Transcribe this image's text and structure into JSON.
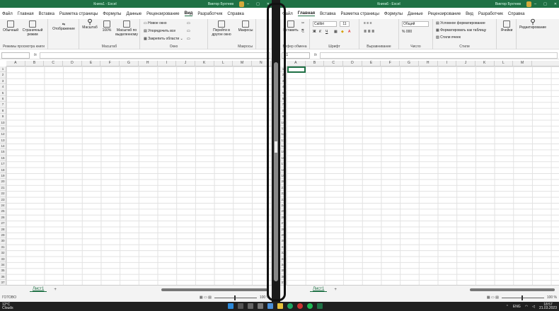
{
  "left_window": {
    "title": "Книга1 - Excel",
    "user": "Виктор Бухтеев",
    "menu": [
      "Файл",
      "Главная",
      "Вставка",
      "Разметка страницы",
      "Формулы",
      "Данные",
      "Рецензирование",
      "Вид",
      "Разработчик",
      "Справка"
    ],
    "active_menu": "Вид",
    "ribbon": {
      "normal": "Обычный",
      "page_mode": "Страничный режим",
      "views_group": "Режимы просмотра книги",
      "display": "Отображение",
      "zoom": "Масштаб",
      "zoom_100": "100%",
      "zoom_selection": "Масштаб по выделенному",
      "zoom_group": "Масштаб",
      "new_window": "Новое окно",
      "arrange_all": "Упорядочить все",
      "freeze_panes": "Закрепить области",
      "window_group": "Окно",
      "switch_windows": "Перейти в другое окно",
      "macros": "Макросы",
      "macros_group": "Макросы"
    },
    "columns": [
      "A",
      "B",
      "C",
      "D",
      "E",
      "F",
      "G",
      "H",
      "I",
      "J",
      "K",
      "L",
      "M",
      "N"
    ],
    "sheet_tab": "Лист1",
    "status_left": "ГОТОВО",
    "zoom_pct": "100 %"
  },
  "right_window": {
    "title": "Книга6 - Excel",
    "user": "Виктор Бухтеев",
    "menu": [
      "Файл",
      "Главная",
      "Вставка",
      "Разметка страницы",
      "Формулы",
      "Данные",
      "Рецензирование",
      "Вид",
      "Разработчик",
      "Справка"
    ],
    "active_menu": "Главная",
    "ribbon": {
      "paste": "Вставить",
      "clipboard": "Буфер обмена",
      "font_name": "Calibri",
      "font_size": "11",
      "font_group": "Шрифт",
      "alignment_group": "Выравнивание",
      "number_format": "Общий",
      "number_group": "Число",
      "conditional": "Условное форматирование",
      "format_table": "Форматировать как таблицу",
      "cell_styles": "Стили ячеек",
      "styles_group": "Стили",
      "cells": "Ячейки",
      "editing": "Редактирование"
    },
    "name_box": "A1",
    "columns": [
      "A",
      "B",
      "C",
      "D",
      "E",
      "F",
      "G",
      "H",
      "I",
      "J",
      "K",
      "L",
      "M"
    ],
    "sheet_tab": "Лист1",
    "zoom_pct": "100 %"
  },
  "row_numbers": [
    "1",
    "2",
    "3",
    "4",
    "5",
    "6",
    "7",
    "8",
    "9",
    "10",
    "11",
    "12",
    "13",
    "14",
    "15",
    "16",
    "17",
    "18",
    "19",
    "20",
    "21",
    "22",
    "23",
    "24",
    "25",
    "26",
    "27",
    "28",
    "29",
    "30",
    "31",
    "32",
    "33",
    "34",
    "35",
    "36",
    "37"
  ],
  "taskbar": {
    "temp": "12°C",
    "weather": "Clouds",
    "lang": "ENG",
    "time": "18:57",
    "date": "21.03.2023"
  },
  "colors": {
    "excel_green": "#1f7145",
    "taskbar": "#202020"
  }
}
